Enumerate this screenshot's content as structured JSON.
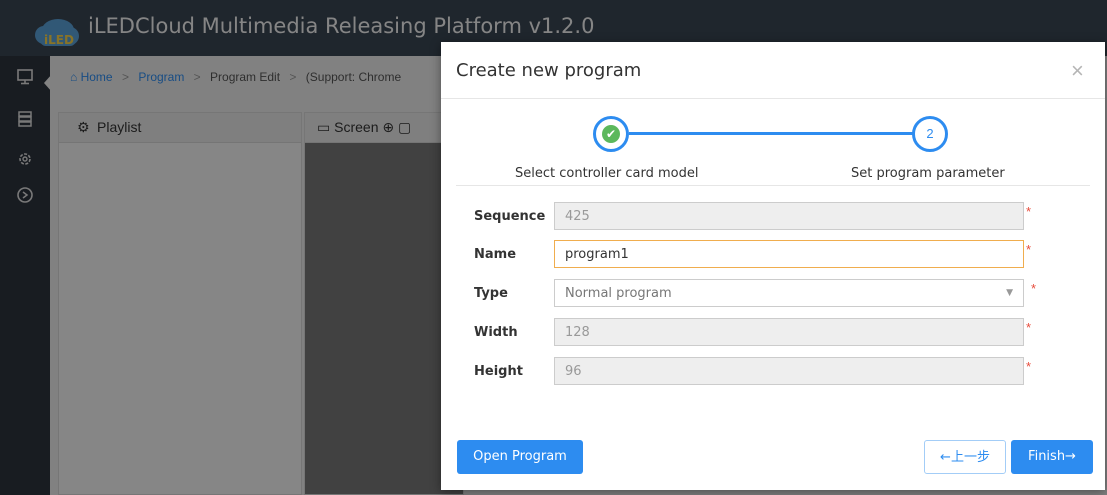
{
  "app": {
    "title": "iLEDCloud Multimedia Releasing Platform v1.2.0",
    "logo_text": "iLED"
  },
  "breadcrumb": {
    "home": "Home",
    "sep": ">",
    "program": "Program",
    "current": "Program Edit",
    "support": "(Support: Chrome"
  },
  "panels": {
    "playlist": "Playlist",
    "screen": "Screen"
  },
  "modal": {
    "title": "Create new program",
    "close": "×",
    "steps": [
      {
        "label": "Select controller card model",
        "status": "done"
      },
      {
        "number": "2",
        "label": "Set program parameter",
        "status": "current"
      }
    ],
    "fields": {
      "sequence": {
        "label": "Sequence",
        "value": "425"
      },
      "name": {
        "label": "Name",
        "value": "program1"
      },
      "type": {
        "label": "Type",
        "value": "Normal program"
      },
      "width": {
        "label": "Width",
        "value": "128"
      },
      "height": {
        "label": "Height",
        "value": "96"
      }
    },
    "required_mark": "*",
    "buttons": {
      "open": "Open Program",
      "prev": "←上一步",
      "finish": "Finish→"
    }
  },
  "colors": {
    "accent": "#2d8cf0",
    "success": "#5cb85c",
    "required": "#e74c3c",
    "topbar": "#3a4553"
  }
}
